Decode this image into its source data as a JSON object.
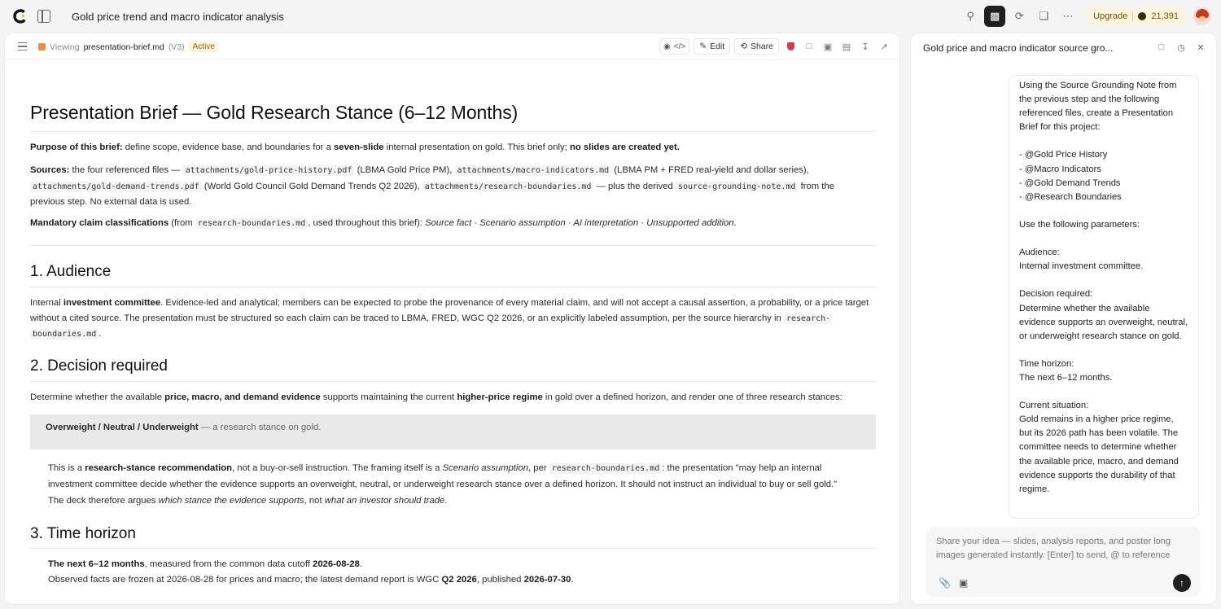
{
  "app": {
    "title": "Gold price trend and macro indicator analysis",
    "upgrade_label": "Upgrade",
    "credits": "21,391"
  },
  "doc": {
    "viewing_label": "Viewing",
    "filename": "presentation-brief.md",
    "version": "(V3)",
    "status": "Active",
    "edit_label": "Edit",
    "share_label": "Share",
    "title": "Presentation Brief — Gold Research Stance (6–12 Months)",
    "purpose": {
      "label": "Purpose of this brief:",
      "text1": " define scope, evidence base, and boundaries for a ",
      "bold1": "seven-slide",
      "text2": " internal presentation on gold. This brief only; ",
      "bold2": "no slides are created yet."
    },
    "sources": {
      "label": "Sources:",
      "t1": " the four referenced files — ",
      "c1": "attachments/gold-price-history.pdf",
      "t2": " (LBMA Gold Price PM), ",
      "c2": "attachments/macro-indicators.md",
      "t3": " (LBMA PM + FRED real-yield and dollar series),",
      "c3": "attachments/gold-demand-trends.pdf",
      "t4": " (World Gold Council Gold Demand Trends Q2 2026), ",
      "c4": "attachments/research-boundaries.md",
      "t5": " — plus the derived ",
      "c5": "source-grounding-note.md",
      "t6": " from the",
      "t7": "previous step. No external data is used."
    },
    "mandatory": {
      "label": "Mandatory claim classifications",
      "t1": " (from ",
      "code": "research-boundaries.md",
      "t2": ", used throughout this brief): ",
      "italic": "Source fact · Scenario assumption · AI interpretation · Unsupported addition",
      "t3": "."
    },
    "s1": {
      "heading": "1. Audience",
      "t1": "Internal ",
      "b1": "investment committee",
      "t2": ". Evidence-led and analytical; members can be expected to probe the provenance of every material claim, and will not accept a causal assertion, a probability, or a price target",
      "t3": "without a cited source. The presentation must be structured so each claim can be traced to LBMA, FRED, WGC Q2 2026, or an explicitly labeled assumption, per the source hierarchy in ",
      "c1": "research-",
      "c2": "boundaries.md",
      "t4": "."
    },
    "s2": {
      "heading": "2. Decision required",
      "t1": "Determine whether the available ",
      "b1": "price, macro, and demand evidence",
      "t2": " supports maintaining the current ",
      "b2": "higher-price regime",
      "t3": " in gold over a defined horizon, and render one of three research stances:",
      "callout_bold": "Overweight / Neutral / Underweight",
      "callout_muted": " — a research stance on gold.",
      "p2_t1": "This is a ",
      "p2_b1": "research-stance recommendation",
      "p2_t2": ", not a buy-or-sell instruction. The framing itself is a ",
      "p2_i1": "Scenario assumption",
      "p2_t3": ", per ",
      "p2_c1": "research-boundaries.md",
      "p2_t4": ": the presentation \"may help an internal",
      "p2_t5": "investment committee decide whether the evidence supports an overweight, neutral, or underweight research stance over a defined horizon. It should not instruct an individual to buy or sell gold.\"",
      "p3_t1": "The deck therefore argues ",
      "p3_i1": "which stance the evidence supports",
      "p3_t2": ", not ",
      "p3_i2": "what an investor should trade",
      "p3_t3": "."
    },
    "s3": {
      "heading": "3. Time horizon",
      "b1": "The next 6–12 months",
      "t1": ", measured from the common data cutoff ",
      "b2": "2026-08-28",
      "t2": ".",
      "t3": "Observed facts are frozen at 2026-08-28 for prices and macro; the latest demand report is WGC ",
      "b3": "Q2 2026",
      "t4": ", published ",
      "b4": "2026-07-30",
      "t5": "."
    }
  },
  "chat": {
    "title": "Gold price and macro indicator source gro...",
    "message": "Using the Source Grounding Note from the previous step and the following referenced files, create a Presentation Brief for this project:\n\n- @Gold Price History\n- @Macro Indicators\n- @Gold Demand Trends\n- @Research Boundaries\n\nUse the following parameters:\n\nAudience:\nInternal investment committee.\n\nDecision required:\nDetermine whether the available evidence supports an overweight, neutral, or underweight research stance on gold.\n\nTime horizon:\nThe next 6–12 months.\n\nCurrent situation:\nGold remains in a higher price regime, but its 2026 path has been volatile. The committee needs to determine whether the available price, macro, and demand evidence supports the durability of that regime.",
    "placeholder": "Share your idea — slides, analysis reports, and poster long images generated instantly. [Enter] to send, @ to reference"
  }
}
